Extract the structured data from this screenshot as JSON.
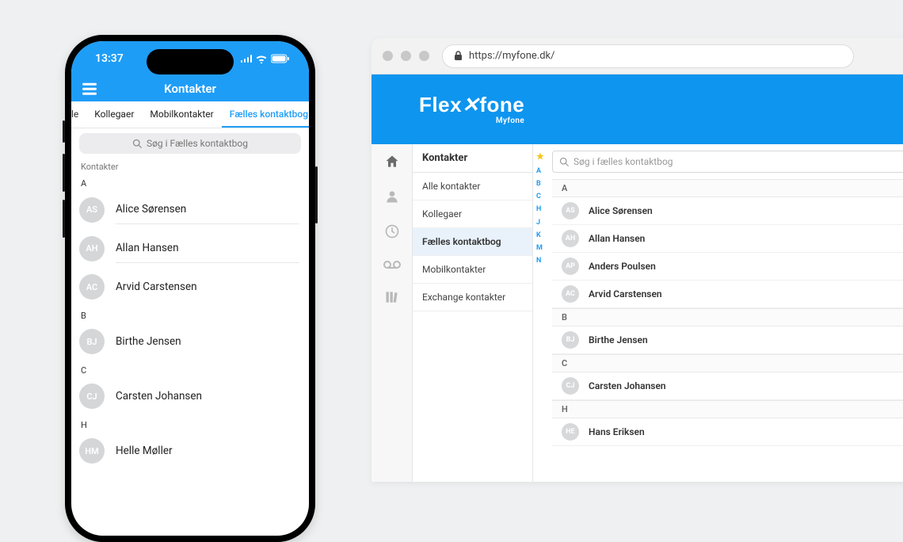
{
  "phone": {
    "status": {
      "time": "13:37"
    },
    "app_title": "Kontakter",
    "tabs": {
      "partial": "le",
      "items": [
        "Kollegaer",
        "Mobilkontakter",
        "Fælles kontaktbog"
      ],
      "active": "Fælles kontaktbog"
    },
    "search_placeholder": "Søg i Fælles kontaktbog",
    "list_label": "Kontakter",
    "sections": [
      {
        "letter": "A",
        "contacts": [
          {
            "initials": "AS",
            "name": "Alice Sørensen"
          },
          {
            "initials": "AH",
            "name": "Allan Hansen"
          },
          {
            "initials": "AC",
            "name": "Arvid Carstensen"
          }
        ]
      },
      {
        "letter": "B",
        "contacts": [
          {
            "initials": "BJ",
            "name": "Birthe Jensen"
          }
        ]
      },
      {
        "letter": "C",
        "contacts": [
          {
            "initials": "CJ",
            "name": "Carsten Johansen"
          }
        ]
      },
      {
        "letter": "H",
        "contacts": [
          {
            "initials": "HM",
            "name": "Helle Møller"
          }
        ]
      }
    ]
  },
  "browser": {
    "url": "https://myfone.dk/",
    "brand": {
      "text_a": "Flex",
      "text_b": "fone",
      "sub": "Myfone"
    },
    "sidebar": {
      "title": "Kontakter",
      "items": [
        {
          "label": "Alle kontakter",
          "active": false
        },
        {
          "label": "Kollegaer",
          "active": false
        },
        {
          "label": "Fælles kontaktbog",
          "active": true
        },
        {
          "label": "Mobilkontakter",
          "active": false
        },
        {
          "label": "Exchange kontakter",
          "active": false
        }
      ]
    },
    "index": [
      "A",
      "B",
      "C",
      "H",
      "J",
      "K",
      "M",
      "N"
    ],
    "search_placeholder": "Søg i fælles kontaktbog",
    "sections": [
      {
        "letter": "A",
        "contacts": [
          {
            "initials": "AS",
            "name": "Alice Sørensen"
          },
          {
            "initials": "AH",
            "name": "Allan Hansen"
          },
          {
            "initials": "AP",
            "name": "Anders Poulsen"
          },
          {
            "initials": "AC",
            "name": "Arvid Carstensen"
          }
        ]
      },
      {
        "letter": "B",
        "contacts": [
          {
            "initials": "BJ",
            "name": "Birthe Jensen"
          }
        ]
      },
      {
        "letter": "C",
        "contacts": [
          {
            "initials": "CJ",
            "name": "Carsten Johansen"
          }
        ]
      },
      {
        "letter": "H",
        "contacts": [
          {
            "initials": "HE",
            "name": "Hans Eriksen"
          }
        ]
      }
    ]
  }
}
